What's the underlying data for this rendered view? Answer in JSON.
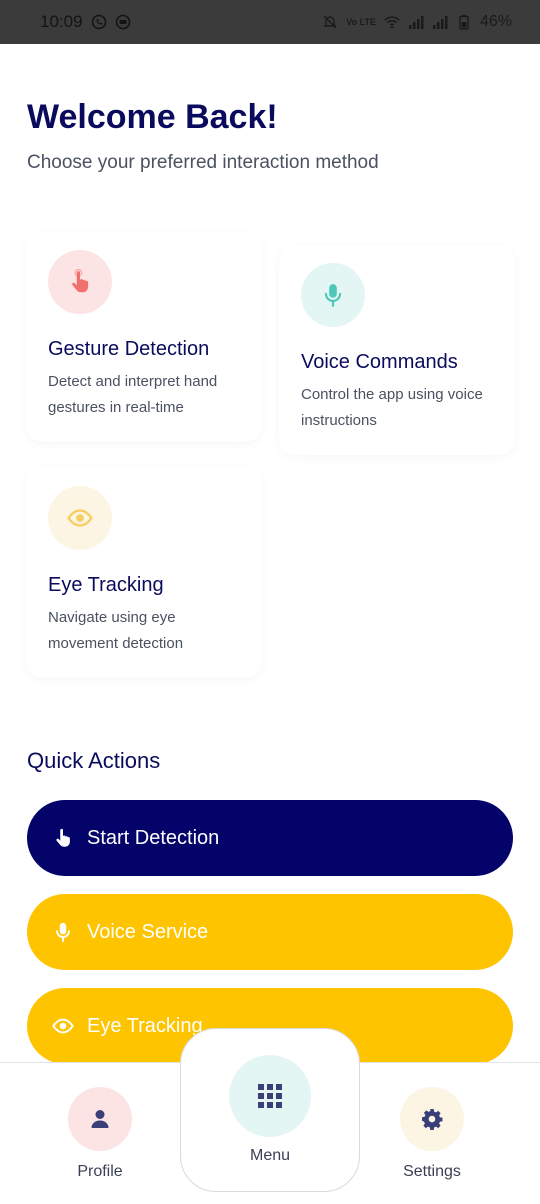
{
  "status_bar": {
    "time": "10:09",
    "network_label": "Vo LTE",
    "battery": "46%",
    "icons": [
      "whatsapp-icon",
      "settings-app-icon",
      "mute-icon",
      "wifi-icon",
      "signal-icon",
      "signal-icon",
      "battery-icon"
    ]
  },
  "header": {
    "title": "Welcome Back!",
    "subtitle": "Choose your preferred interaction method"
  },
  "cards": [
    {
      "id": "gesture",
      "title": "Gesture Detection",
      "description": "Detect and interpret hand gestures in real-time",
      "icon": "hand-pointer-icon",
      "icon_color": "#f0706e",
      "bg_color": "#fde4e4"
    },
    {
      "id": "voice",
      "title": "Voice Commands",
      "description": "Control the app using voice instructions",
      "icon": "microphone-icon",
      "icon_color": "#4fc7b8",
      "bg_color": "#e4f6f4"
    },
    {
      "id": "eye",
      "title": "Eye Tracking",
      "description": "Navigate using eye movement detection",
      "icon": "eye-icon",
      "icon_color": "#f8cd63",
      "bg_color": "#fdf5e3"
    }
  ],
  "quick_actions": {
    "heading": "Quick Actions",
    "buttons": [
      {
        "label": "Start Detection",
        "icon": "hand-pointer-icon",
        "color": "#03036a"
      },
      {
        "label": "Voice Service",
        "icon": "microphone-icon",
        "color": "#ffc400"
      },
      {
        "label": "Eye Tracking",
        "icon": "eye-icon",
        "color": "#ffc400"
      }
    ]
  },
  "bottom_nav": {
    "profile": "Profile",
    "menu": "Menu",
    "settings": "Settings"
  }
}
